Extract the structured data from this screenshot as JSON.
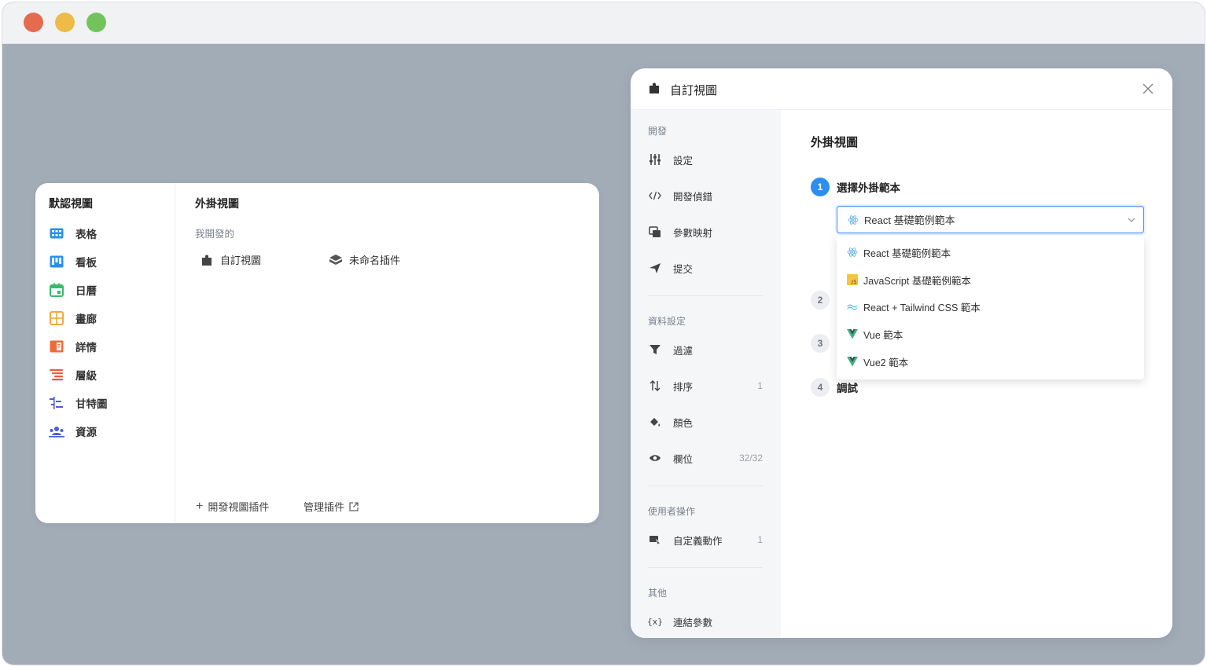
{
  "left_panel": {
    "default_views_title": "默認視圖",
    "views": [
      {
        "label": "表格",
        "icon": "table-grid-icon",
        "color": "#2b8ff0"
      },
      {
        "label": "看板",
        "icon": "kanban-icon",
        "color": "#2b8ff0"
      },
      {
        "label": "日曆",
        "icon": "calendar-icon",
        "color": "#3cb96b"
      },
      {
        "label": "畫廊",
        "icon": "gallery-icon",
        "color": "#f0a93a"
      },
      {
        "label": "詳情",
        "icon": "detail-icon",
        "color": "#ef6a3a"
      },
      {
        "label": "層級",
        "icon": "hierarchy-icon",
        "color": "#ef5a3a"
      },
      {
        "label": "甘特圖",
        "icon": "gantt-icon",
        "color": "#4b5cd8"
      },
      {
        "label": "資源",
        "icon": "resource-icon",
        "color": "#4b5cd8"
      }
    ],
    "plugin_title": "外掛視圖",
    "my_developed": "我開發的",
    "plugins": [
      {
        "label": "自訂視圖",
        "icon": "puzzle-icon"
      },
      {
        "label": "未命名插件",
        "icon": "cube-icon"
      }
    ],
    "develop_button": "開發視圖插件",
    "manage_button": "管理插件"
  },
  "modal": {
    "title": "自訂視圖",
    "nav": {
      "sections": [
        {
          "title": "開發",
          "items": [
            {
              "label": "設定",
              "icon": "sliders-icon",
              "badge": ""
            },
            {
              "label": "開發偵錯",
              "icon": "code-icon",
              "badge": ""
            },
            {
              "label": "參數映射",
              "icon": "mapping-icon",
              "badge": ""
            },
            {
              "label": "提交",
              "icon": "send-icon",
              "badge": ""
            }
          ]
        },
        {
          "title": "資料設定",
          "items": [
            {
              "label": "過濾",
              "icon": "filter-icon",
              "badge": ""
            },
            {
              "label": "排序",
              "icon": "sort-icon",
              "badge": "1"
            },
            {
              "label": "顏色",
              "icon": "paint-bucket-icon",
              "badge": ""
            },
            {
              "label": "欄位",
              "icon": "eye-icon",
              "badge": "32/32"
            }
          ]
        },
        {
          "title": "使用者操作",
          "items": [
            {
              "label": "自定義動作",
              "icon": "action-icon",
              "badge": "1"
            }
          ]
        },
        {
          "title": "其他",
          "items": [
            {
              "label": "連結參數",
              "icon": "braces-icon",
              "badge": ""
            }
          ]
        }
      ]
    },
    "main": {
      "title": "外掛視圖",
      "steps": [
        {
          "num": "1",
          "label": "選擇外掛範本"
        },
        {
          "num": "2",
          "label": ""
        },
        {
          "num": "3",
          "label": ""
        },
        {
          "num": "4",
          "label": "調試"
        }
      ],
      "select_value": "React 基礎範例範本",
      "options": [
        {
          "label": "React 基礎範例範本",
          "icon": "react-icon"
        },
        {
          "label": "JavaScript 基礎範例範本",
          "icon": "javascript-icon"
        },
        {
          "label": "React + Tailwind CSS 範本",
          "icon": "tailwind-icon"
        },
        {
          "label": "Vue 範本",
          "icon": "vue-icon"
        },
        {
          "label": "Vue2 範本",
          "icon": "vue-icon"
        }
      ]
    }
  }
}
